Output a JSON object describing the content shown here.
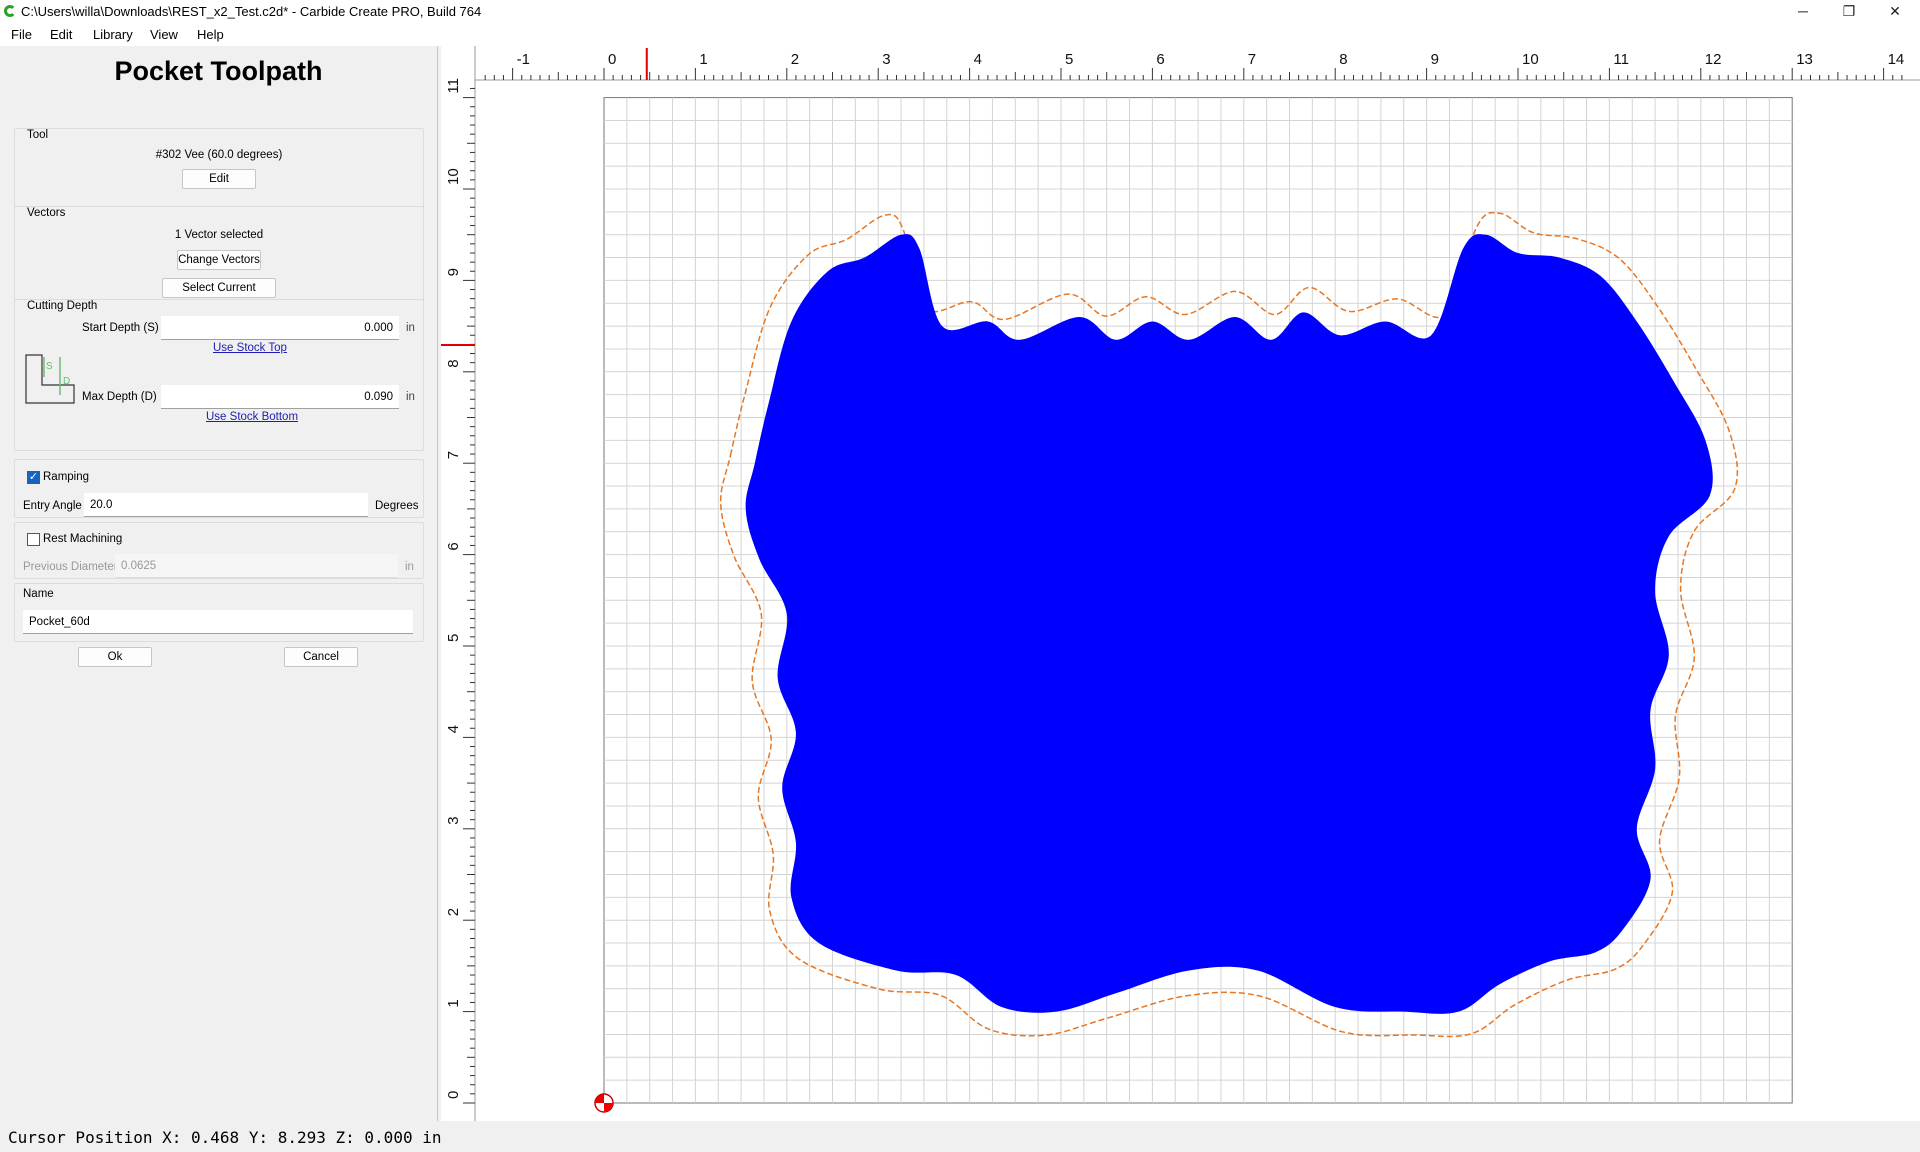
{
  "window": {
    "title": "C:\\Users\\willa\\Downloads\\REST_x2_Test.c2d* - Carbide Create PRO, Build 764",
    "minimize": "─",
    "restore": "❐",
    "close": "✕"
  },
  "menu": {
    "file": "File",
    "edit": "Edit",
    "library": "Library",
    "view": "View",
    "help": "Help"
  },
  "panel": {
    "title": "Pocket Toolpath",
    "tool": {
      "label": "Tool",
      "name": "#302 Vee (60.0 degrees)",
      "edit": "Edit"
    },
    "vectors": {
      "label": "Vectors",
      "status": "1 Vector selected",
      "change": "Change Vectors",
      "select_current": "Select Current Vectors"
    },
    "cutting_depth": {
      "label": "Cutting Depth",
      "start_label": "Start Depth (S)",
      "start_value": "0.000",
      "start_unit": "in",
      "use_stock_top": "Use Stock Top",
      "max_label": "Max Depth (D)",
      "max_value": "0.090",
      "max_unit": "in",
      "use_stock_bottom": "Use Stock Bottom",
      "diagram_s": "S",
      "diagram_d": "D"
    },
    "ramping": {
      "label": "Ramping",
      "checked": true,
      "entry_angle_label": "Entry Angle",
      "entry_angle_value": "20.0",
      "unit": "Degrees"
    },
    "rest": {
      "label": "Rest Machining",
      "checked": false,
      "prev_label": "Previous Diameter",
      "prev_value": "0.0625",
      "unit": "in"
    },
    "name": {
      "label": "Name",
      "value": "Pocket_60d"
    },
    "ok": "Ok",
    "cancel": "Cancel"
  },
  "canvas": {
    "x_ticks": [
      "-1",
      "0",
      "1",
      "2",
      "3",
      "4",
      "5",
      "6",
      "7",
      "8",
      "9",
      "10",
      "11",
      "12",
      "13",
      "14"
    ],
    "y_ticks": [
      "0",
      "1",
      "2",
      "3",
      "4",
      "5",
      "6",
      "7",
      "8",
      "9",
      "10",
      "11"
    ],
    "cursor_x": 0.468,
    "cursor_y": 8.293,
    "pocket_color": "#0000ff",
    "offset_color": "#e87722",
    "cursor_color": "#e00000"
  },
  "status": {
    "cursor": "Cursor Position X: 0.468 Y: 8.293 Z: 0.000 in"
  }
}
